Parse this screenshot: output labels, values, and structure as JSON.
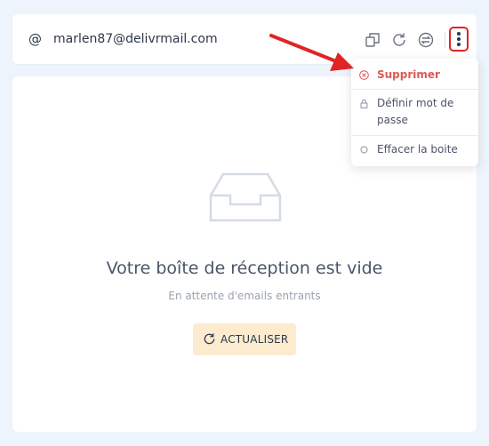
{
  "header": {
    "at_symbol": "@",
    "email": "marlen87@delivrmail.com"
  },
  "icons": {
    "copy": "copy-icon",
    "refresh": "refresh-icon",
    "swap": "swap-icon",
    "more": "more-vertical-icon",
    "inbox": "inbox-icon"
  },
  "menu": {
    "items": [
      {
        "label": "Supprimer",
        "icon": "close-circle-icon",
        "color": "#e05858"
      },
      {
        "label": "Définir mot de passe",
        "icon": "lock-icon"
      },
      {
        "label": "Effacer la boite",
        "icon": "circle-icon"
      }
    ]
  },
  "empty_state": {
    "title": "Votre boîte de réception est vide",
    "subtitle": "En attente d'emails entrants",
    "refresh_label": "ACTUALISER"
  },
  "colors": {
    "background": "#eef4fb",
    "accent_red": "#e02424",
    "button_bg": "#fcebcf"
  }
}
